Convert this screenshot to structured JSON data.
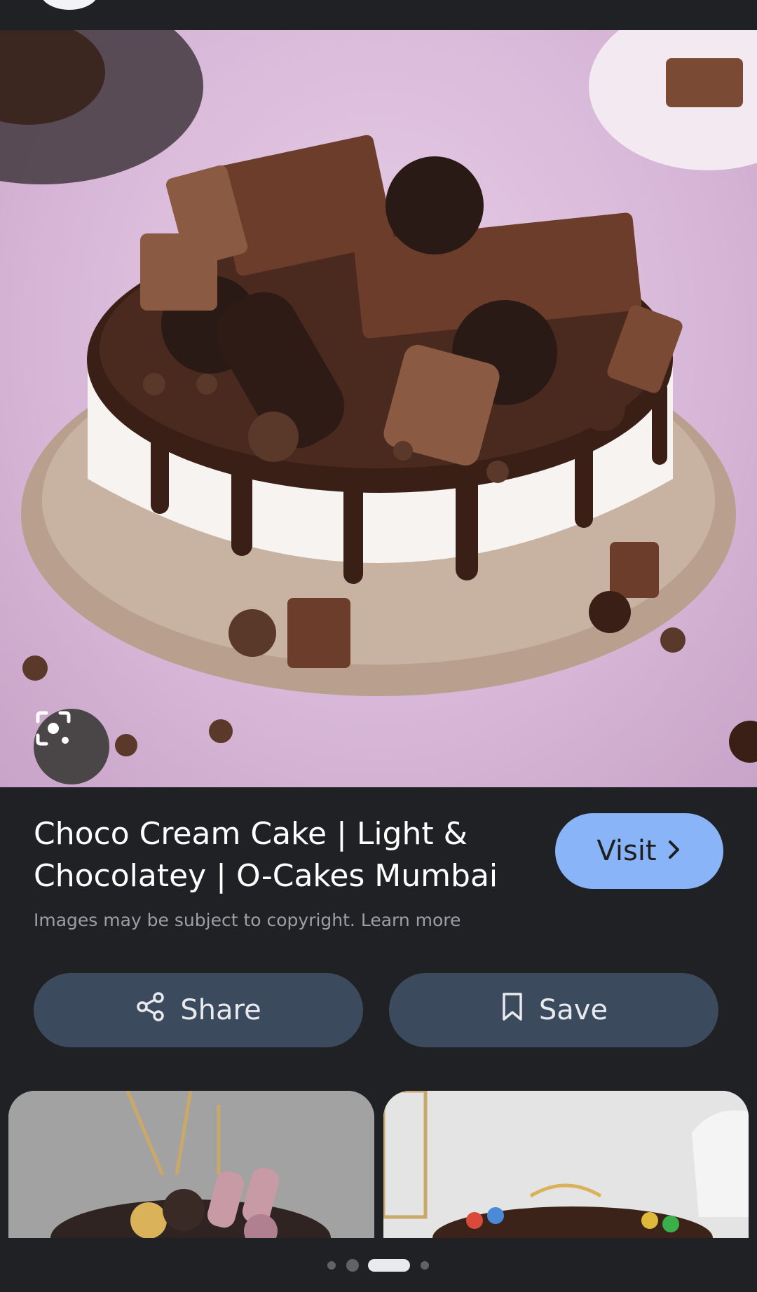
{
  "result": {
    "title": "Choco Cream Cake | Light & Chocolatey | O-Cakes Mumbai",
    "copyright_text": "Images may be subject to copyright.",
    "learn_more": "Learn more",
    "visit_label": "Visit"
  },
  "actions": {
    "share_label": "Share",
    "save_label": "Save"
  },
  "icons": {
    "lens": "lens-icon",
    "share": "share-icon",
    "save": "bookmark-icon",
    "visit": "chevron-right-icon"
  },
  "colors": {
    "background": "#202124",
    "visit_button": "#8ab4f8",
    "action_button": "#3c4a5e"
  },
  "pager": {
    "count": 4,
    "active_index": 2
  }
}
